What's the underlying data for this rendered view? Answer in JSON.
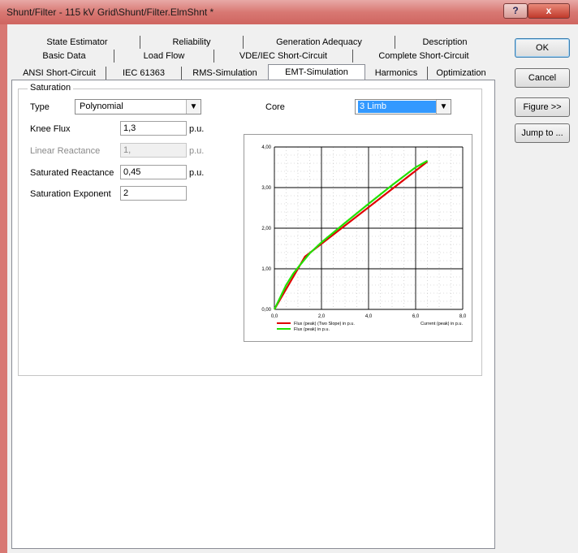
{
  "window": {
    "title": "Shunt/Filter - 115 kV Grid\\Shunt/Filter.ElmShnt *",
    "help_label": "?",
    "close_label": "x"
  },
  "tabs": {
    "row1": [
      "State Estimator",
      "Reliability",
      "Generation Adequacy",
      "Description"
    ],
    "row2": [
      "Basic Data",
      "Load Flow",
      "VDE/IEC Short-Circuit",
      "Complete Short-Circuit"
    ],
    "row3": [
      "ANSI Short-Circuit",
      "IEC 61363",
      "RMS-Simulation",
      "EMT-Simulation",
      "Harmonics",
      "Optimization"
    ],
    "active": "EMT-Simulation"
  },
  "saturation": {
    "group_title": "Saturation",
    "type_label": "Type",
    "type_value": "Polynomial",
    "core_label": "Core",
    "core_value": "3 Limb",
    "knee_flux_label": "Knee Flux",
    "knee_flux_value": "1,3",
    "knee_flux_unit": "p.u.",
    "linear_reactance_label": "Linear Reactance",
    "linear_reactance_value": "1,",
    "linear_reactance_unit": "p.u.",
    "saturated_reactance_label": "Saturated Reactance",
    "saturated_reactance_value": "0,45",
    "saturated_reactance_unit": "p.u.",
    "saturation_exponent_label": "Saturation Exponent",
    "saturation_exponent_value": "2"
  },
  "buttons": {
    "ok": "OK",
    "cancel": "Cancel",
    "figure": "Figure >>",
    "jump_to": "Jump to ..."
  },
  "chart_data": {
    "type": "line",
    "xlabel": "Current (peak) in p.u.",
    "xlim": [
      0,
      8
    ],
    "ylim": [
      0,
      4
    ],
    "x_ticks": [
      "0,0",
      "2,0",
      "4,0",
      "6,0",
      "8,0"
    ],
    "y_ticks": [
      "0,00",
      "1,00",
      "2,00",
      "3,00",
      "4,00"
    ],
    "grid": true,
    "legend_position": "bottom-left",
    "series": [
      {
        "name": "Flux (peak) (Two Slope) in p.u.",
        "color": "#e00000",
        "points": [
          [
            0,
            0
          ],
          [
            1.3,
            1.3
          ],
          [
            6.5,
            3.64
          ]
        ]
      },
      {
        "name": "Flux (peak) in p.u.",
        "color": "#22e000",
        "points": [
          [
            0,
            0
          ],
          [
            0.25,
            0.3
          ],
          [
            0.5,
            0.6
          ],
          [
            0.8,
            0.88
          ],
          [
            1.1,
            1.1
          ],
          [
            1.5,
            1.38
          ],
          [
            2,
            1.65
          ],
          [
            3,
            2.13
          ],
          [
            4,
            2.6
          ],
          [
            5,
            3.06
          ],
          [
            6,
            3.5
          ],
          [
            6.5,
            3.66
          ]
        ]
      }
    ]
  }
}
